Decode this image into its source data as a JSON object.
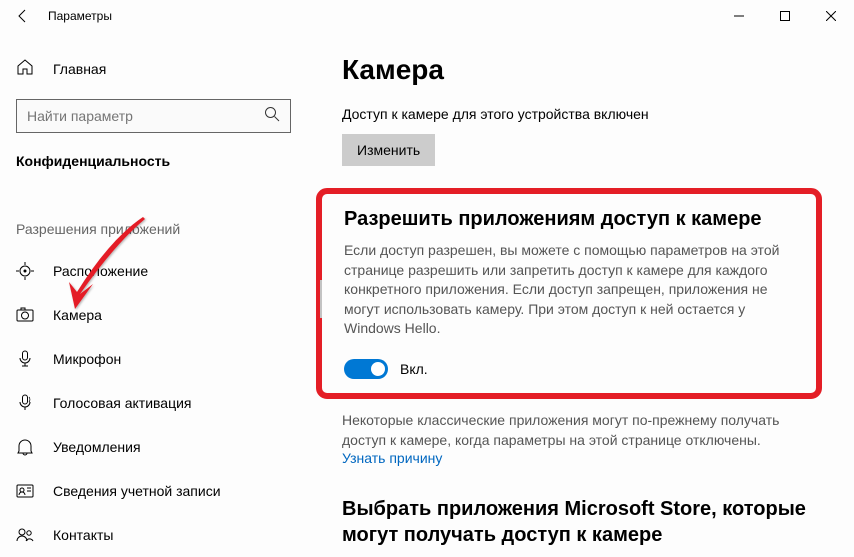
{
  "window": {
    "title": "Параметры"
  },
  "sidebar": {
    "home": "Главная",
    "search_placeholder": "Найти параметр",
    "section": "Конфиденциальность",
    "sub_section": "Разрешения приложений",
    "items": [
      {
        "label": "Расположение"
      },
      {
        "label": "Камера"
      },
      {
        "label": "Микрофон"
      },
      {
        "label": "Голосовая активация"
      },
      {
        "label": "Уведомления"
      },
      {
        "label": "Сведения учетной записи"
      },
      {
        "label": "Контакты"
      }
    ]
  },
  "main": {
    "title": "Камера",
    "device_status": "Доступ к камере для этого устройства включен",
    "change_button": "Изменить",
    "allow_heading": "Разрешить приложениям доступ к камере",
    "allow_desc": "Если доступ разрешен, вы можете с помощью параметров на этой странице разрешить или запретить доступ к камере для каждого конкретного приложения. Если доступ запрещен, приложения не могут использовать камеру. При этом доступ к ней остается у Windows Hello.",
    "toggle_label": "Вкл.",
    "classic_note": "Некоторые классические приложения могут по-прежнему получать доступ к камере, когда параметры на этой странице отключены.",
    "learn_why": "Узнать причину",
    "store_heading": "Выбрать приложения Microsoft Store, которые могут получать доступ к камере"
  }
}
